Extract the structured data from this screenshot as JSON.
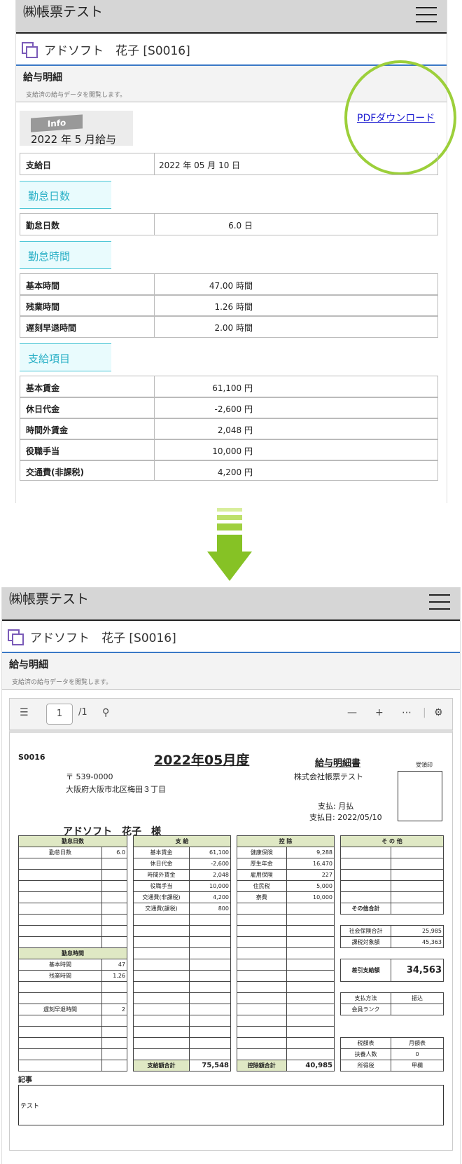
{
  "app": {
    "brand": "㈱帳票テスト",
    "user": "アドソフト　花子 [S0016]"
  },
  "page": {
    "title": "給与明細",
    "subtitle": "支給済の給与データを閲覧します。"
  },
  "info": {
    "tag": "Info",
    "month": "2022 年 5 月給与",
    "pdf_link": "PDFダウンロード"
  },
  "pay_date": {
    "label": "支給日",
    "value": "2022 年 05 月 10 日"
  },
  "sections": {
    "days": "勤怠日数",
    "hours": "勤怠時間",
    "pay": "支給項目"
  },
  "days_rows": [
    {
      "k": "勤怠日数",
      "v": "6.0 日"
    }
  ],
  "hour_rows": [
    {
      "k": "基本時間",
      "v": "47.00 時間"
    },
    {
      "k": "残業時間",
      "v": "1.26 時間"
    },
    {
      "k": "遅刻早退時間",
      "v": "2.00 時間"
    }
  ],
  "pay_rows": [
    {
      "k": "基本賃金",
      "v": "61,100 円"
    },
    {
      "k": "休日代金",
      "v": "-2,600 円"
    },
    {
      "k": "時間外賃金",
      "v": "2,048 円"
    },
    {
      "k": "役職手当",
      "v": "10,000 円"
    },
    {
      "k": "交通費(非課税)",
      "v": "4,200 円"
    }
  ],
  "viewer": {
    "page": "1",
    "total": "/1"
  },
  "slip": {
    "code": "S0016",
    "title": "2022年05月度",
    "doc": "給与明細書",
    "zip": "〒 539-0000",
    "addr": "大阪府大阪市北区梅田３丁目",
    "company": "株式会社帳票テスト",
    "method": "支払: 月払",
    "date": "支払日: 2022/05/10",
    "stamp": "受領印",
    "name": "アドソフト　花子　様",
    "h_days": "勤怠日数",
    "h_pay": "支 給",
    "h_ded": "控 除",
    "h_oth": "そ の 他",
    "h_hours": "勤怠時間",
    "d_k": "勤怠日数",
    "d_v": "6.0",
    "hours": [
      [
        "基本時間",
        "47"
      ],
      [
        "残業時間",
        "1.26"
      ],
      [
        "遅刻早退時間",
        "2"
      ]
    ],
    "pay": [
      [
        "基本賃金",
        "61,100"
      ],
      [
        "休日代金",
        "-2,600"
      ],
      [
        "時間外賃金",
        "2,048"
      ],
      [
        "役職手当",
        "10,000"
      ],
      [
        "交通費(非課税)",
        "4,200"
      ],
      [
        "交通費(課税)",
        "800"
      ]
    ],
    "ded": [
      [
        "健康保険",
        "9,288"
      ],
      [
        "厚生年金",
        "16,470"
      ],
      [
        "雇用保険",
        "227"
      ],
      [
        "住民税",
        "5,000"
      ],
      [
        "寮費",
        "10,000"
      ]
    ],
    "oth_total": "その他合計",
    "soc_k": "社会保険合計",
    "soc_v": "25,985",
    "tax_k": "課税対象額",
    "tax_v": "45,363",
    "net_k": "差引支給額",
    "net_v": "34,563",
    "pm_k": "支払方法",
    "pm_v": "振込",
    "rank_k": "会員ランク",
    "tt_k": "税額表",
    "tt_v": "月額表",
    "dep_k": "扶養人数",
    "dep_v": "0",
    "it_k": "所得税",
    "it_v": "甲欄",
    "pay_total_k": "支給額合計",
    "pay_total_v": "75,548",
    "ded_total_k": "控除額合計",
    "ded_total_v": "40,985",
    "memo_k": "記事",
    "memo_v": "テスト"
  }
}
